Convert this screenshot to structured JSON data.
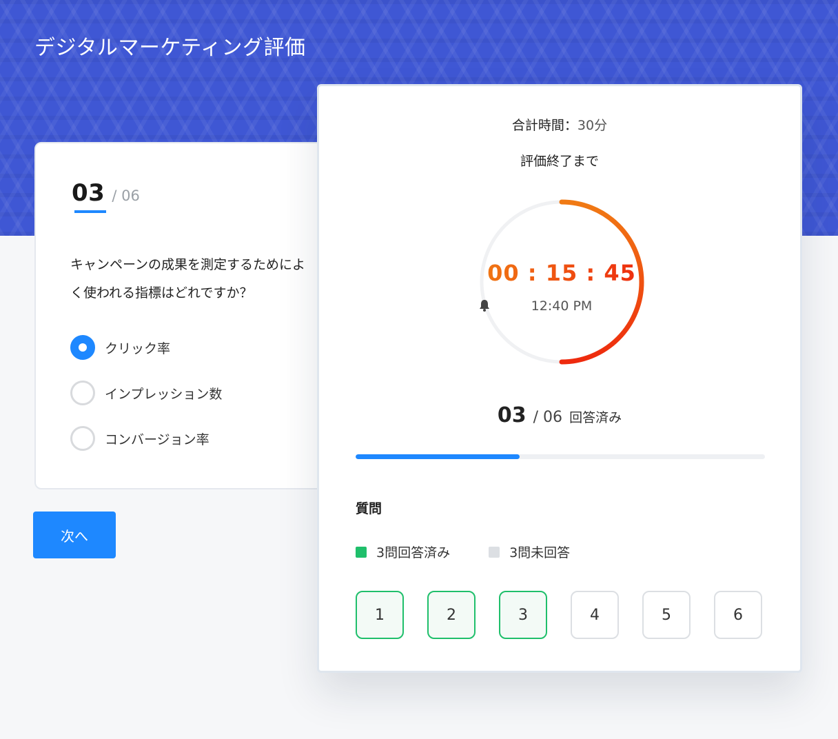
{
  "page_title": "デジタルマーケティング評価",
  "question": {
    "current": "03",
    "total": "/ 06",
    "text": "キャンペーンの成果を測定するためによく使われる指標はどれですか？",
    "options": [
      {
        "label": "クリック率",
        "selected": true
      },
      {
        "label": "インプレッション数",
        "selected": false
      },
      {
        "label": "コンバージョン率",
        "selected": false
      }
    ]
  },
  "next_button": "次へ",
  "panel": {
    "total_time_label": "合計時間：",
    "total_time_value": "30分",
    "until_end": "評価終了まで",
    "timer": "00 : 15 : 45",
    "alarm_time": "12:40 PM",
    "timer_progress": 0.5,
    "answered_current": "03",
    "answered_total": "/ 06",
    "answered_label": "回答済み",
    "progress_fraction": 0.4,
    "questions_heading": "質問",
    "legend": [
      {
        "label": "3問回答済み",
        "color": "#1fbf6b"
      },
      {
        "label": "3問未回答",
        "color": "#dcdfe3"
      }
    ],
    "questions": [
      {
        "num": "1",
        "done": true
      },
      {
        "num": "2",
        "done": true
      },
      {
        "num": "3",
        "done": true
      },
      {
        "num": "4",
        "done": false
      },
      {
        "num": "5",
        "done": false
      },
      {
        "num": "6",
        "done": false
      }
    ]
  },
  "colors": {
    "header": "#3f57d4",
    "accent": "#1e88ff",
    "timer_start": "#f07a14",
    "timer_end": "#ee2a0e",
    "answered": "#1fbf6b"
  }
}
